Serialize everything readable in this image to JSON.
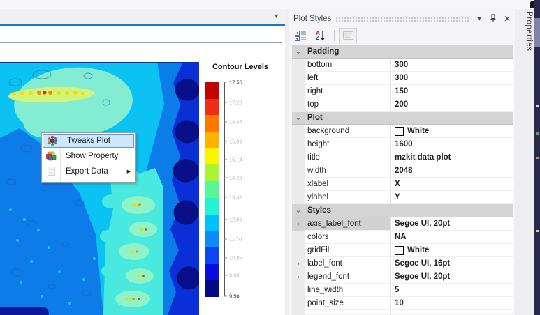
{
  "doc": {
    "tab_dropdown_icon": "▼"
  },
  "context_menu": {
    "items": [
      {
        "icon": "tweaks-gear-icon",
        "label": "Tweaks Plot",
        "highlighted": true
      },
      {
        "icon": "show-property-icon",
        "label": "Show Property"
      },
      {
        "icon": "export-data-icon",
        "label": "Export Data",
        "submenu_arrow": "▶"
      }
    ]
  },
  "legend": {
    "title": "Contour Levels",
    "ticks": [
      "17.50",
      "17.28",
      "16.85",
      "15.99",
      "15.14",
      "14.28",
      "13.42",
      "12.56",
      "11.70",
      "10.85",
      "9.99",
      "9.56"
    ],
    "bar_colors": [
      "#c00505",
      "#ee2f16",
      "#fe7700",
      "#ffb300",
      "#fcf500",
      "#aaf337",
      "#57f796",
      "#25f2d3",
      "#00c1fd",
      "#0d8bfb",
      "#0b46f5",
      "#0b0ddc",
      "#050a7e"
    ]
  },
  "panel": {
    "title": "Plot Styles",
    "titlebar": {
      "menu_icon": "▼",
      "pin_icon": "pin-icon",
      "close_icon": "✕"
    },
    "toolbar": {
      "sort_a": "A",
      "sort_z": "Z",
      "sort_arrow": "↓"
    },
    "grid": {
      "glyphs": {
        "expanded": "⌄",
        "more": "›"
      },
      "rows": [
        {
          "type": "category",
          "name": "Padding"
        },
        {
          "type": "prop",
          "name": "bottom",
          "value": "300"
        },
        {
          "type": "prop",
          "name": "left",
          "value": "300"
        },
        {
          "type": "prop",
          "name": "right",
          "value": "150"
        },
        {
          "type": "prop",
          "name": "top",
          "value": "200"
        },
        {
          "type": "category",
          "name": "Plot"
        },
        {
          "type": "prop",
          "name": "background",
          "value": "White",
          "swatch": "#ffffff"
        },
        {
          "type": "prop",
          "name": "height",
          "value": "1600"
        },
        {
          "type": "prop",
          "name": "title",
          "value": "mzkit data plot"
        },
        {
          "type": "prop",
          "name": "width",
          "value": "2048"
        },
        {
          "type": "prop",
          "name": "xlabel",
          "value": "X"
        },
        {
          "type": "prop",
          "name": "ylabel",
          "value": "Y"
        },
        {
          "type": "category",
          "name": "Styles"
        },
        {
          "type": "prop",
          "name": "axis_label_font",
          "value": "Segoe UI, 20pt",
          "expandable": true,
          "selected": true
        },
        {
          "type": "prop",
          "name": "colors",
          "value": "NA"
        },
        {
          "type": "prop",
          "name": "gridFill",
          "value": "White",
          "swatch": "#ffffff"
        },
        {
          "type": "prop",
          "name": "label_font",
          "value": "Segoe UI, 16pt",
          "expandable": true
        },
        {
          "type": "prop",
          "name": "legend_font",
          "value": "Segoe UI, 20pt",
          "expandable": true
        },
        {
          "type": "prop",
          "name": "line_width",
          "value": "5"
        },
        {
          "type": "prop",
          "name": "point_size",
          "value": "10"
        }
      ]
    }
  },
  "right_tab": {
    "label": "Properties"
  },
  "chart_data": {
    "type": "heatmap",
    "title": "Contour Levels",
    "legend_levels": [
      17.5,
      17.28,
      16.85,
      15.99,
      15.14,
      14.28,
      13.42,
      12.56,
      11.7,
      10.85,
      9.99,
      9.56
    ],
    "legend_colors": [
      "#c00505",
      "#ee2f16",
      "#fe7700",
      "#ffb300",
      "#fcf500",
      "#aaf337",
      "#57f796",
      "#25f2d3",
      "#00c1fd",
      "#0d8bfb",
      "#0b46f5",
      "#0b0ddc",
      "#050a7e"
    ],
    "palette_note_colors": {
      "base_cyan": "#0cc2f3",
      "pale_aqua": "#83ecd2",
      "hot_streak": "#cef47c",
      "mid_blue": "#0d7ce9",
      "dark_band": "#0b2fd6",
      "navy": "#071089"
    }
  }
}
